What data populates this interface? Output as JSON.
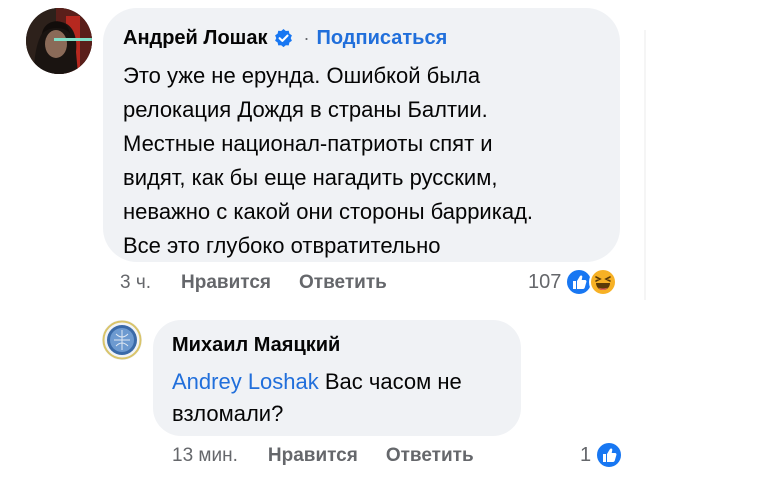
{
  "colors": {
    "bubble": "#f0f2f5",
    "link": "#216fdb",
    "meta": "#65676b",
    "like_blue": "#1877f2",
    "haha_yellow": "#f7b125"
  },
  "comment": {
    "author": "Андрей Лошак",
    "verified_icon": "verified-badge-icon",
    "separator": "·",
    "follow_label": "Подписаться",
    "lines": [
      "Это уже не ерунда. Ошибкой была",
      "релокация Дождя в страны Балтии.",
      "Местные национал-патриоты спят и",
      "видят, как бы еще нагадить русским,",
      "неважно с какой они стороны баррикад.",
      "Все это глубоко отвратительно"
    ],
    "time": "3 ч.",
    "like_label": "Нравится",
    "reply_label": "Ответить",
    "reaction_count": "107",
    "reactions": [
      "like-icon",
      "haha-icon"
    ]
  },
  "reply": {
    "author": "Михаил Маяцкий",
    "mention": "Andrey Loshak",
    "text_after_mention": " Вас часом не",
    "text_line2": "взломали?",
    "time": "13 мин.",
    "like_label": "Нравится",
    "reply_label": "Ответить",
    "reaction_count": "1",
    "reactions": [
      "like-icon"
    ]
  }
}
